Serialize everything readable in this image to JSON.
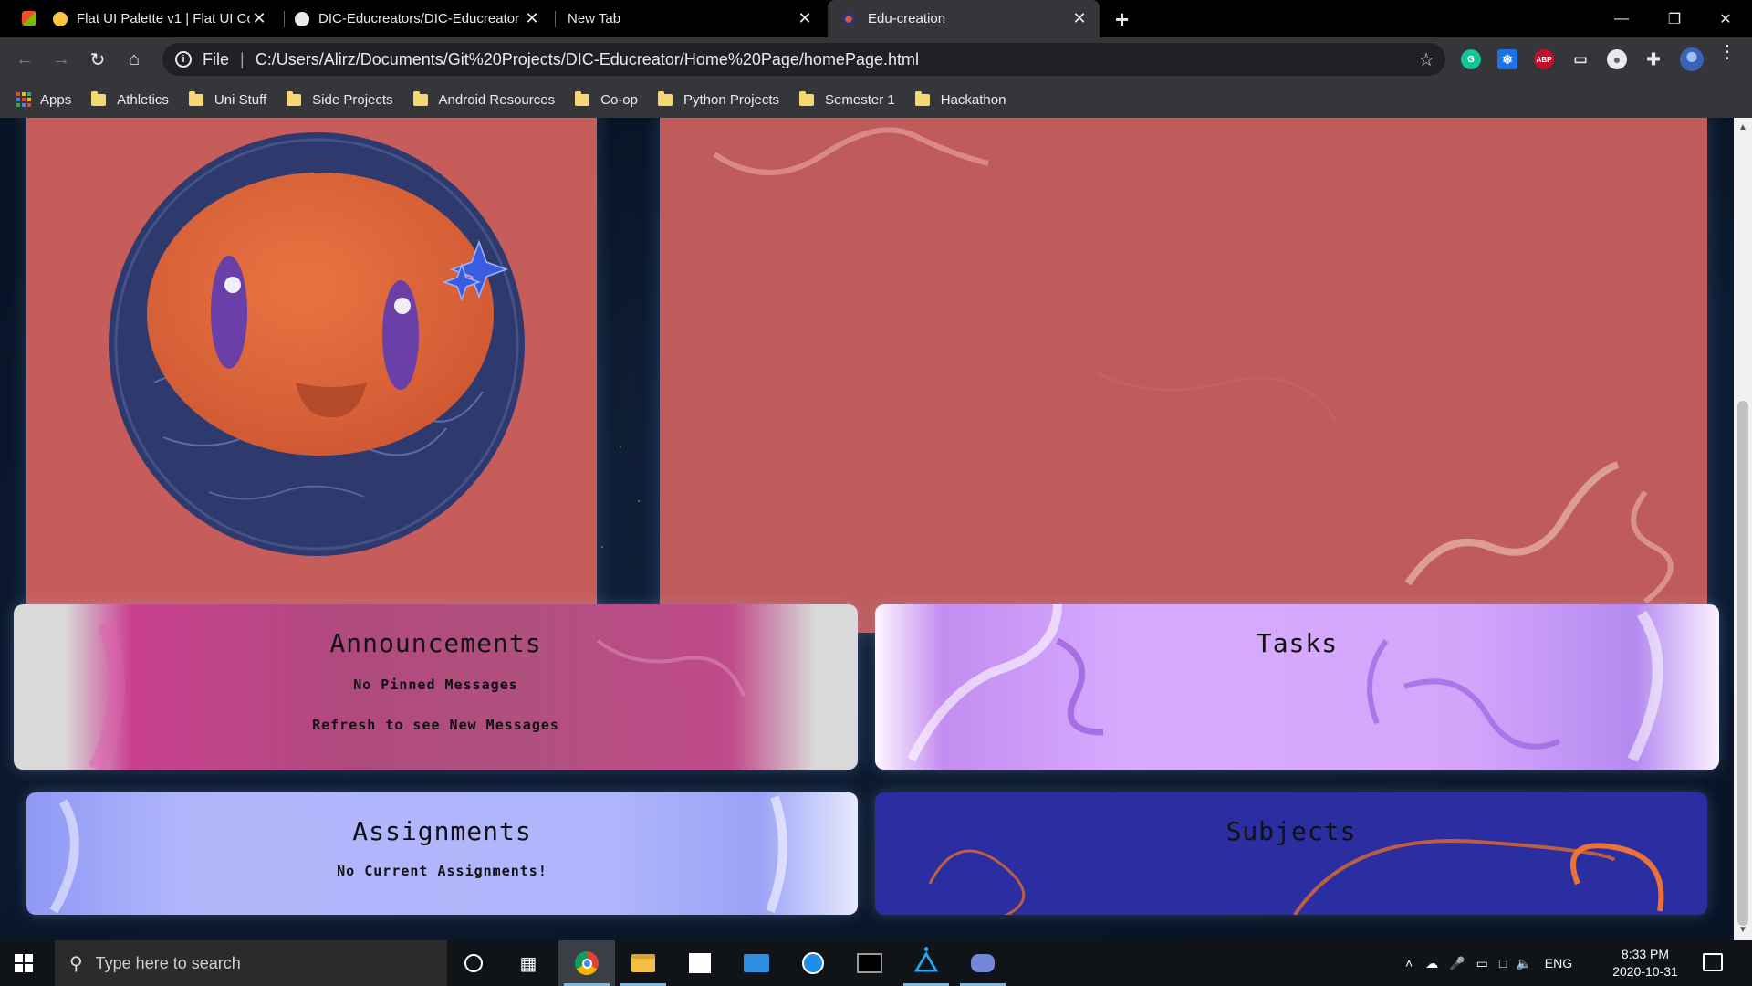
{
  "browser": {
    "tabs": [
      {
        "title": "Flat UI Palette v1 | Flat UI Col",
        "active": false
      },
      {
        "title": "DIC-Educreators/DIC-Educreator",
        "active": false
      },
      {
        "title": "New Tab",
        "active": false
      },
      {
        "title": "Edu-creation",
        "active": true
      }
    ],
    "new_tab_symbol": "+",
    "close_symbol": "✕",
    "window_controls": [
      "—",
      "❐",
      "✕"
    ]
  },
  "toolbar": {
    "info_symbol": "i",
    "scheme_label": "File",
    "separator": "|",
    "url": "C:/Users/Alirz/Documents/Git%20Projects/DIC-Educreator/Home%20Page/homePage.html",
    "star_symbol": "☆",
    "extensions": [
      {
        "name": "grammarly-icon",
        "label": "G",
        "color": "#15c39a"
      },
      {
        "name": "snowflake-extension-icon",
        "label": "❄",
        "color": "#1a73e8"
      },
      {
        "name": "adblock-plus-icon",
        "label": "ABP",
        "color": "#c70d2c"
      },
      {
        "name": "cast-extension-icon",
        "label": "▭",
        "color": "#5f6368"
      },
      {
        "name": "record-extension-icon",
        "label": "●",
        "color": "#5f6368"
      },
      {
        "name": "extensions-puzzle-icon",
        "label": "✚",
        "color": "#35363a"
      },
      {
        "name": "profile-avatar",
        "label": "",
        "color": "#5b8bd9"
      }
    ]
  },
  "bookmarks": {
    "apps_label": "Apps",
    "items": [
      "Athletics",
      "Uni Stuff",
      "Side Projects",
      "Android Resources",
      "Co-op",
      "Python Projects",
      "Semester 1",
      "Hackathon"
    ]
  },
  "page": {
    "announcements": {
      "title": "Announcements",
      "line1": "No Pinned Messages",
      "line2": "Refresh to see New Messages"
    },
    "tasks": {
      "title": "Tasks"
    },
    "assignments": {
      "title": "Assignments",
      "line1": "No Current Assignments!"
    },
    "subjects": {
      "title": "Subjects"
    }
  },
  "taskbar": {
    "search_placeholder": "Type here to search",
    "language": "ENG",
    "time": "8:33 PM",
    "date": "2020-10-31"
  }
}
